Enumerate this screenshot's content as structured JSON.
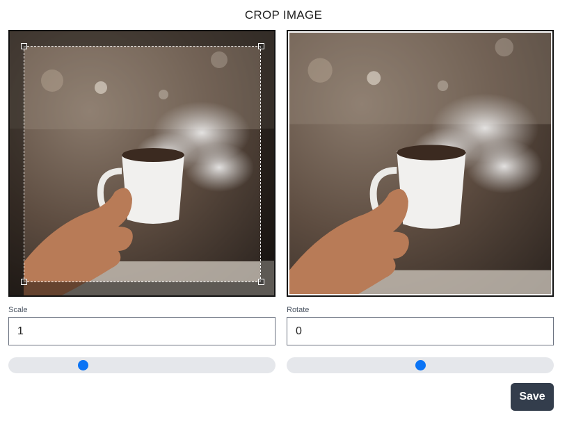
{
  "header": {
    "title": "CROP IMAGE"
  },
  "crop_panel": {
    "image_icon": "coffee-cup-photo"
  },
  "preview_panel": {
    "image_icon": "coffee-cup-photo"
  },
  "scale": {
    "label": "Scale",
    "value": "1",
    "slider_fraction": 0.27
  },
  "rotate": {
    "label": "Rotate",
    "value": "0",
    "slider_fraction": 0.5
  },
  "actions": {
    "save_label": "Save"
  },
  "colors": {
    "accent": "#0b74f5",
    "button_bg": "#333d4c",
    "slider_track": "#e5e7eb"
  }
}
